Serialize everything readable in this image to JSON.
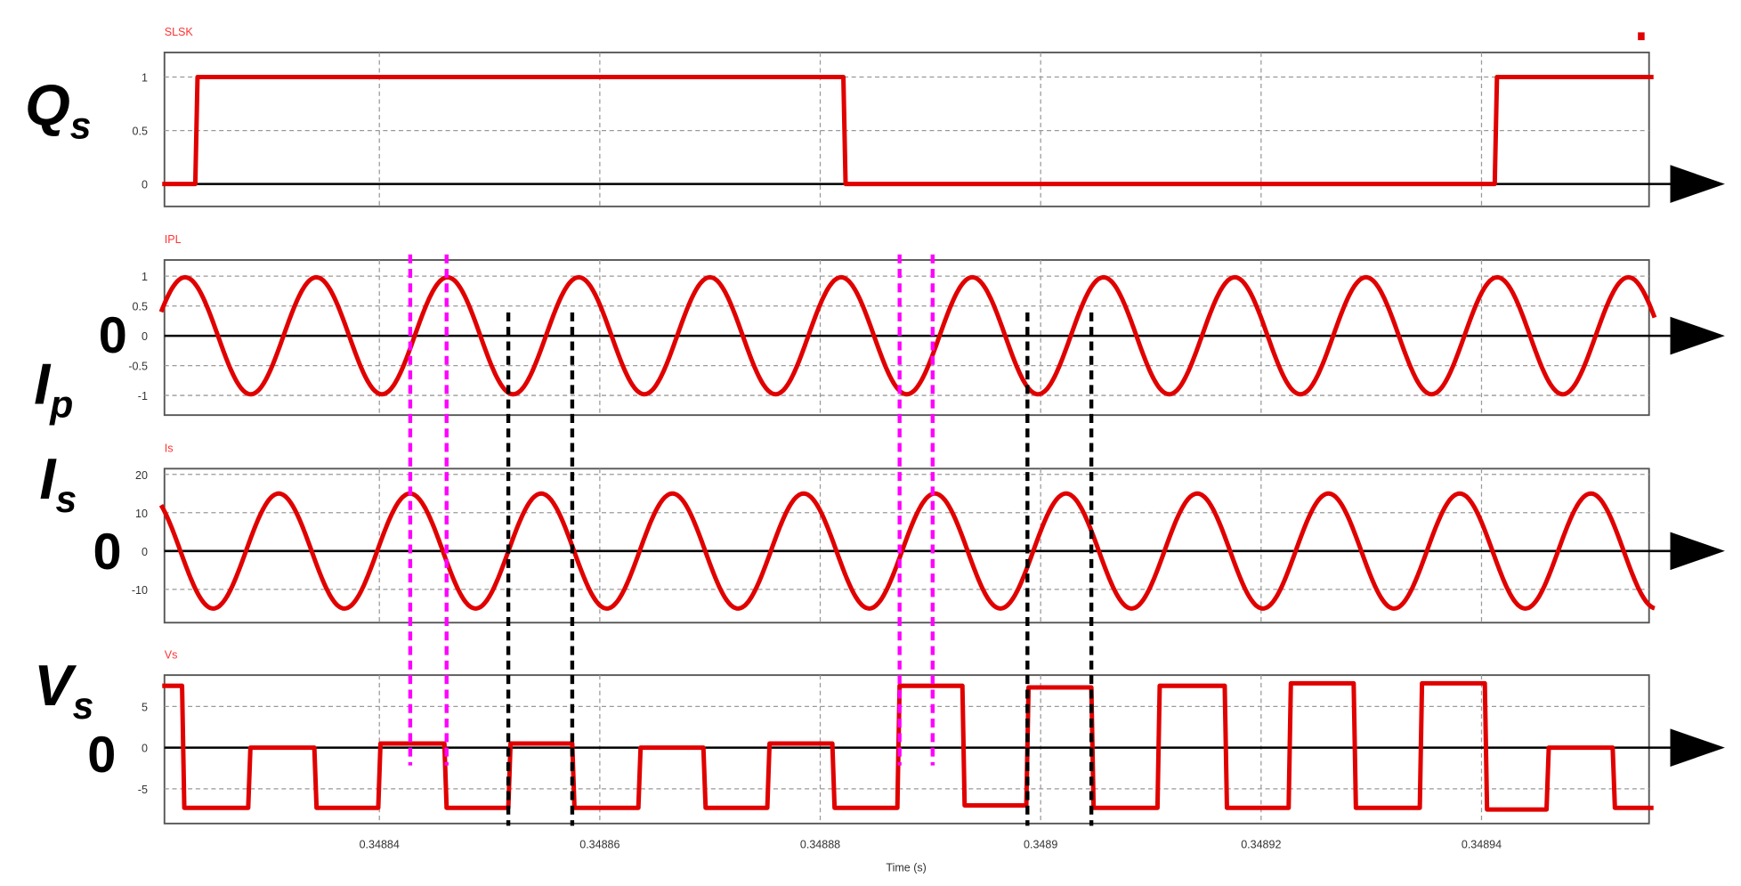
{
  "chart_data": {
    "type": "line",
    "xlabel": "Time (s)",
    "xlim": [
      0.3488205,
      0.3489552
    ],
    "xticks": [
      "0.34884",
      "0.34886",
      "0.34888",
      "0.3489",
      "0.34892",
      "0.34894"
    ],
    "xtick_values": [
      0.34884,
      0.34886,
      0.34888,
      0.3489,
      0.34892,
      0.34894
    ],
    "grid": true,
    "colors": {
      "trace": "#e00000",
      "axis": "#000000",
      "marker_phase": "#ff00ff",
      "marker_zero": "#000000"
    },
    "panels": [
      {
        "id": "qs",
        "title": "SLSK",
        "side_label": "Q",
        "side_sub": "s",
        "zero_label": "",
        "ylim": [
          -0.21,
          1.23
        ],
        "yticks": [
          "1",
          "0.5",
          "0"
        ],
        "ytick_values": [
          1,
          0.5,
          0
        ],
        "kind": "step",
        "transitions": [
          0.3488234,
          0.3488822,
          0.3489413
        ],
        "levels": [
          0,
          1,
          0,
          1
        ]
      },
      {
        "id": "ip",
        "title": "IPL",
        "side_label": "I",
        "side_sub": "p",
        "zero_label": "0",
        "ylim": [
          -1.33,
          1.27
        ],
        "yticks": [
          "1",
          "0.5",
          "0",
          "-0.5",
          "-1"
        ],
        "ytick_values": [
          1,
          0.5,
          0,
          -0.5,
          -1
        ],
        "kind": "sine",
        "amplitude": 0.98,
        "frequency_hz": 84000,
        "rising_zero_time": 0.3488194
      },
      {
        "id": "is",
        "title": "Is",
        "side_label": "I",
        "side_sub": "s",
        "zero_label": "0",
        "ylim": [
          -18.7,
          21.5
        ],
        "yticks": [
          "20",
          "10",
          "0",
          "-10"
        ],
        "ytick_values": [
          20,
          10,
          0,
          -10
        ],
        "kind": "sine",
        "amplitude": 15,
        "frequency_hz": 84000,
        "rising_zero_time": 0.3488279
      },
      {
        "id": "vs",
        "title": "Vs",
        "side_label": "V",
        "side_sub": "s",
        "zero_label": "0",
        "ylim": [
          -9.2,
          8.8
        ],
        "yticks": [
          "5",
          "0",
          "-5"
        ],
        "ytick_values": [
          5,
          0,
          -5
        ],
        "kind": "step",
        "transitions": [
          0.3488222,
          0.3488282,
          0.3488342,
          0.34884,
          0.348846,
          0.3488518,
          0.3488576,
          0.3488636,
          0.3488695,
          0.3488753,
          0.3488812,
          0.3488871,
          0.348893,
          0.3488988,
          0.3489047,
          0.3489107,
          0.3489168,
          0.3489226,
          0.3489285,
          0.3489345,
          0.3489404,
          0.348946,
          0.348952
        ],
        "levels": [
          7.5,
          -7.3,
          0,
          -7.3,
          0.5,
          -7.3,
          0.5,
          -7.3,
          0,
          -7.3,
          0.5,
          -7.3,
          7.5,
          -7,
          7.3,
          -7.3,
          7.5,
          -7.3,
          7.8,
          -7.3,
          7.8,
          -7.5,
          0,
          -7.3
        ]
      }
    ],
    "markers": [
      {
        "type": "phase",
        "time": 0.3488428
      },
      {
        "type": "phase",
        "time": 0.3488461
      },
      {
        "type": "phase",
        "time": 0.3488872
      },
      {
        "type": "phase",
        "time": 0.3488902
      },
      {
        "type": "zero",
        "time": 0.3488517
      },
      {
        "type": "zero",
        "time": 0.3488575
      },
      {
        "type": "zero",
        "time": 0.3488988
      },
      {
        "type": "zero",
        "time": 0.3489046
      }
    ]
  }
}
